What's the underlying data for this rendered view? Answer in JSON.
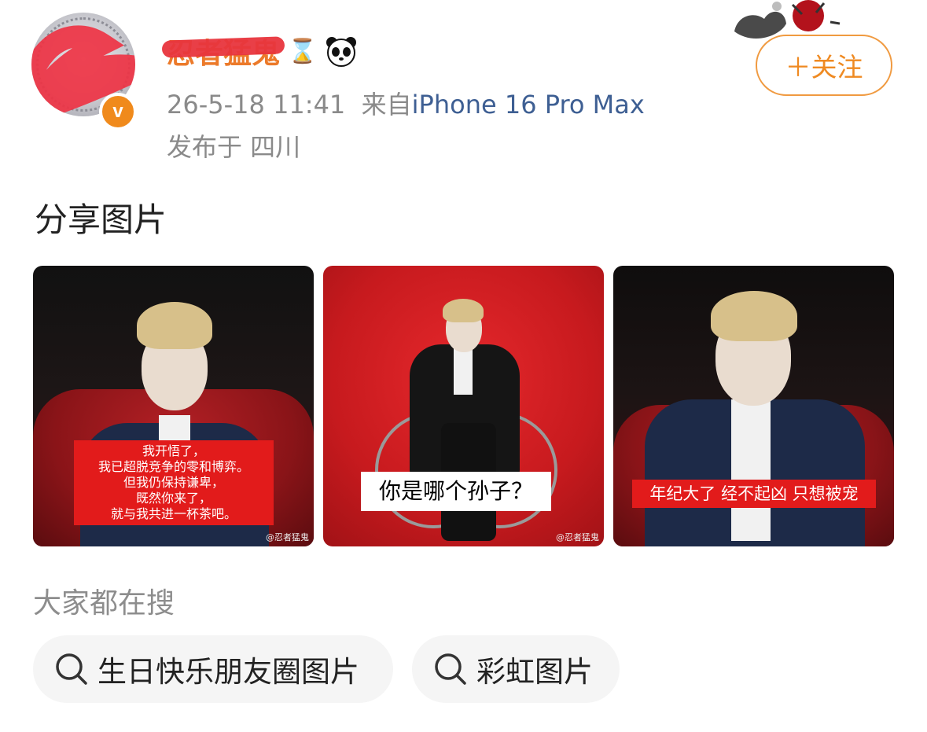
{
  "post": {
    "username": "忍者猛鬼",
    "badge_icons": [
      "hourglass-icon",
      "panda-icon"
    ],
    "timestamp": "26-5-18 11:41",
    "from_label": "来自",
    "device": "iPhone 16 Pro Max",
    "location": "发布于 四川",
    "follow_label": "＋关注",
    "text": "分享图片",
    "verified_mark": "v"
  },
  "images": [
    {
      "caption_lines": [
        "我开悟了，",
        "我已超脱竞争的零和博弈。",
        "但我仍保持谦卑，",
        "既然你来了，",
        "就与我共进一杯茶吧。"
      ],
      "watermark": "@忍者猛鬼"
    },
    {
      "caption": "你是哪个孙子？",
      "watermark": "@忍者猛鬼"
    },
    {
      "caption": "年纪大了 经不起凶 只想被宠",
      "watermark": ""
    }
  ],
  "search": {
    "title": "大家都在搜",
    "chips": [
      "生日快乐朋友圈图片",
      "彩虹图片"
    ]
  },
  "colors": {
    "accent_orange": "#ef8a22",
    "device_blue": "#3e5f93",
    "caption_red": "#e21b1b"
  }
}
